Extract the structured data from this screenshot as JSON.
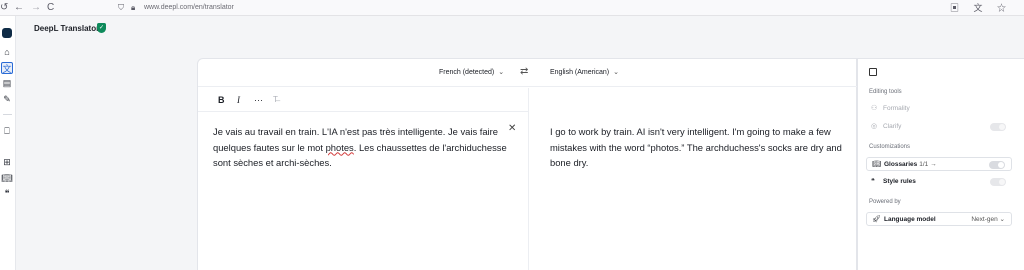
{
  "browser": {
    "url": "www.deepl.com/en/translator",
    "nav_back": "←",
    "nav_forward": "→",
    "nav_reload": "C",
    "right_icons": "▣ 文 ☆"
  },
  "app": {
    "title": "DeepL Translator"
  },
  "rail": {
    "items": [
      "home-icon",
      "translate-icon",
      "document-icon",
      "write-icon",
      "bookmark-icon",
      "apps-icon",
      "book-icon",
      "quote-icon"
    ]
  },
  "translator": {
    "source_lang": "French (detected)",
    "target_lang": "English (American)",
    "swap_symbol": "⇄",
    "chevron": "⌄",
    "format": {
      "bold": "B",
      "italic": "I",
      "more": "···",
      "clear": "T̶"
    },
    "source_text_before": "Je vais au travail en train. L'IA n'est pas très intelligente. Je vais faire quelques fautes sur le mot ",
    "source_typo": "photes",
    "source_text_after": ". Les chaussettes de l'archiduchesse sont sèches et archi-sèches.",
    "close_symbol": "✕",
    "target_text": "I go to work by train. AI isn't very intelligent. I'm going to make a few mistakes with the word “photos.” The archduchess's socks are dry and bone dry."
  },
  "panel": {
    "editing_tools": "Editing tools",
    "formality": "Formality",
    "clarify": "Clarify",
    "customizations": "Customizations",
    "glossaries": "Glossaries",
    "glossaries_count": "1/1 →",
    "style_rules": "Style rules",
    "powered_by": "Powered by",
    "language_model": "Language model",
    "language_model_value": "Next-gen ⌄"
  }
}
